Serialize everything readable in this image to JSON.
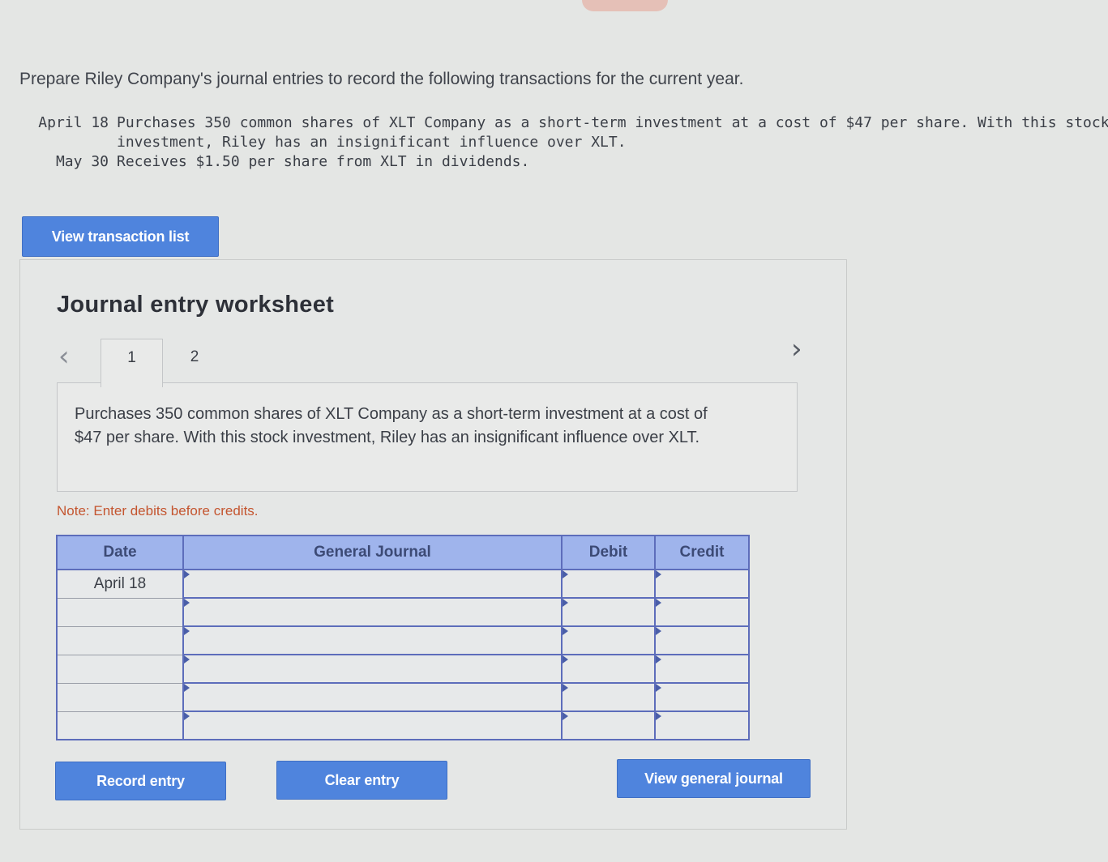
{
  "instructions": "Prepare Riley Company's journal entries to record the following transactions for the current year.",
  "transactions": [
    {
      "date": "April 18",
      "description": "Purchases 350 common shares of XLT Company as a short-term investment at a cost of $47 per share. With this stock investment, Riley has an insignificant influence over XLT."
    },
    {
      "date": "May 30",
      "description": "Receives $1.50 per share from XLT in dividends."
    }
  ],
  "buttons": {
    "view_transaction_list": "View transaction list",
    "record_entry": "Record entry",
    "clear_entry": "Clear entry",
    "view_general_journal": "View general journal"
  },
  "worksheet": {
    "title": "Journal entry worksheet",
    "prev_icon": "chevron-left-icon",
    "next_icon": "chevron-right-icon",
    "tabs": [
      "1",
      "2"
    ],
    "active_tab": "1",
    "description": "Purchases 350 common shares of XLT Company as a short-term investment at a cost of $47 per share. With this stock investment, Riley has an insignificant influence over XLT.",
    "note": "Note: Enter debits before credits."
  },
  "journal": {
    "headers": {
      "date": "Date",
      "general_journal": "General Journal",
      "debit": "Debit",
      "credit": "Credit"
    },
    "rows": [
      {
        "date": "April 18",
        "account": "",
        "debit": "",
        "credit": ""
      },
      {
        "date": "",
        "account": "",
        "debit": "",
        "credit": ""
      },
      {
        "date": "",
        "account": "",
        "debit": "",
        "credit": ""
      },
      {
        "date": "",
        "account": "",
        "debit": "",
        "credit": ""
      },
      {
        "date": "",
        "account": "",
        "debit": "",
        "credit": ""
      },
      {
        "date": "",
        "account": "",
        "debit": "",
        "credit": ""
      }
    ]
  },
  "colors": {
    "button_blue": "#4f84dd",
    "table_header": "#9fb4ec",
    "table_border": "#5d6dbb",
    "note_orange": "#c4552f"
  }
}
